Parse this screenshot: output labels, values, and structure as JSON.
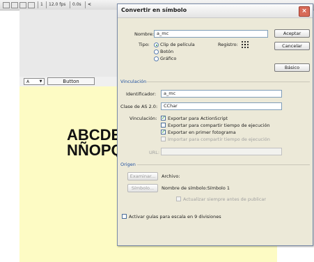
{
  "toolbar": {
    "frame": "1",
    "fps": "12.0 fps",
    "time": "0.0s",
    "scroll_left": "<"
  },
  "stage": {
    "instance_name": "A",
    "button_label": "Button",
    "text_line1": "ABCDE",
    "text_line2": "NÑOPQ"
  },
  "dialog": {
    "title": "Convertir en símbolo",
    "close": "×",
    "name_label": "Nombre:",
    "name_value": "a_mc",
    "type_label": "Tipo:",
    "type_options": [
      "Clip de película",
      "Botón",
      "Gráfico"
    ],
    "register_label": "Registro:",
    "accept": "Aceptar",
    "cancel": "Cancelar",
    "basic": "Básico",
    "linkage_section": "Vinculación",
    "identifier_label": "Identificador:",
    "identifier_value": "a_mc",
    "as_class_label": "Clase de AS 2.0:",
    "as_class_value": "CChar",
    "linkage_label": "Vinculación:",
    "export_as": "Exportar para ActionScript",
    "export_share": "Exportar para compartir tiempo de ejecución",
    "export_first_frame": "Exportar en primer fotograma",
    "import_share": "Importar para compartir tiempo de ejecución",
    "url_label": "URL:",
    "source_section": "Origen",
    "browse": "Examinar...",
    "file_label": "Archivo:",
    "symbol_btn": "Símbolo...",
    "symbol_name": "Nombre de símbolo:Símbolo 1",
    "always_update": "Actualizar siempre antes de publicar",
    "guides": "Activar guías para escala en 9 divisiones"
  }
}
